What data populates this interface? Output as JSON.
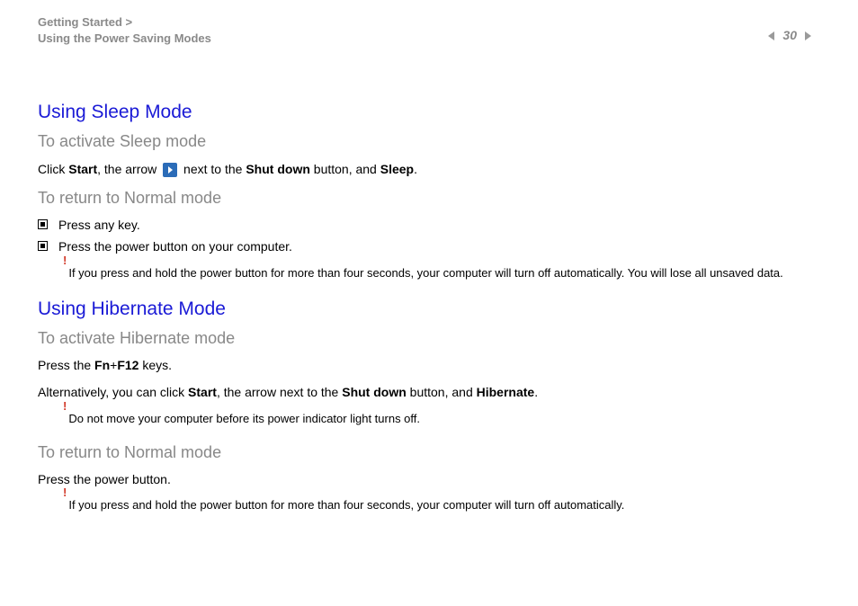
{
  "header": {
    "breadcrumb_line1": "Getting Started >",
    "breadcrumb_line2": "Using the Power Saving Modes",
    "page_number": "30"
  },
  "content": {
    "section1": {
      "title": "Using Sleep Mode",
      "sub1": "To activate Sleep mode",
      "p1_a": "Click ",
      "p1_b": "Start",
      "p1_c": ", the arrow ",
      "p1_d": " next to the ",
      "p1_e": "Shut down",
      "p1_f": " button, and ",
      "p1_g": "Sleep",
      "p1_h": ".",
      "sub2": "To return to Normal mode",
      "bullets": [
        "Press any key.",
        "Press the power button on your computer."
      ],
      "note1": "If you press and hold the power button for more than four seconds, your computer will turn off automatically. You will lose all unsaved data."
    },
    "section2": {
      "title": "Using Hibernate Mode",
      "sub1": "To activate Hibernate mode",
      "p1_a": "Press the ",
      "p1_b": "Fn",
      "p1_c": "+",
      "p1_d": "F12",
      "p1_e": " keys.",
      "p2_a": "Alternatively, you can click ",
      "p2_b": "Start",
      "p2_c": ", the arrow next to the ",
      "p2_d": "Shut down",
      "p2_e": " button, and ",
      "p2_f": "Hibernate",
      "p2_g": ".",
      "note1": "Do not move your computer before its power indicator light turns off.",
      "sub2": "To return to Normal mode",
      "p3": "Press the power button.",
      "note2": "If you press and hold the power button for more than four seconds, your computer will turn off automatically."
    }
  }
}
